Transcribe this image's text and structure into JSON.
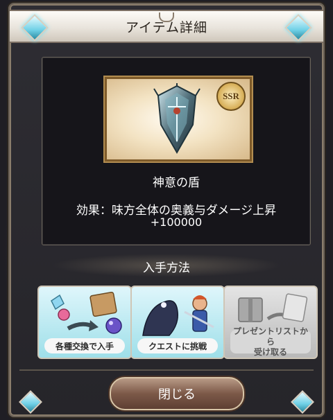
{
  "dialog": {
    "title": "アイテム詳細"
  },
  "item": {
    "name": "神意の盾",
    "rarity": "SSR",
    "effect": "効果：味方全体の奥義与ダメージ上昇",
    "effect_value": "+100000",
    "icon": "shield-icon"
  },
  "acquire": {
    "heading": "入手方法",
    "methods": [
      {
        "label": "各種交換で入手",
        "icon": "exchange-icon",
        "enabled": true
      },
      {
        "label": "クエストに挑戦",
        "icon": "quest-icon",
        "enabled": true
      },
      {
        "label": "プレゼントリストから受け取る",
        "icon": "present-icon",
        "enabled": false
      }
    ]
  },
  "buttons": {
    "close_label": "閉じる"
  },
  "colors": {
    "title_bar": "#e9e4dc",
    "panel": "#16151a",
    "method_active": "#9edfe9",
    "method_disabled": "#b9b9b9",
    "close_button": "#7c5948",
    "gem": "#6fd0e6"
  }
}
